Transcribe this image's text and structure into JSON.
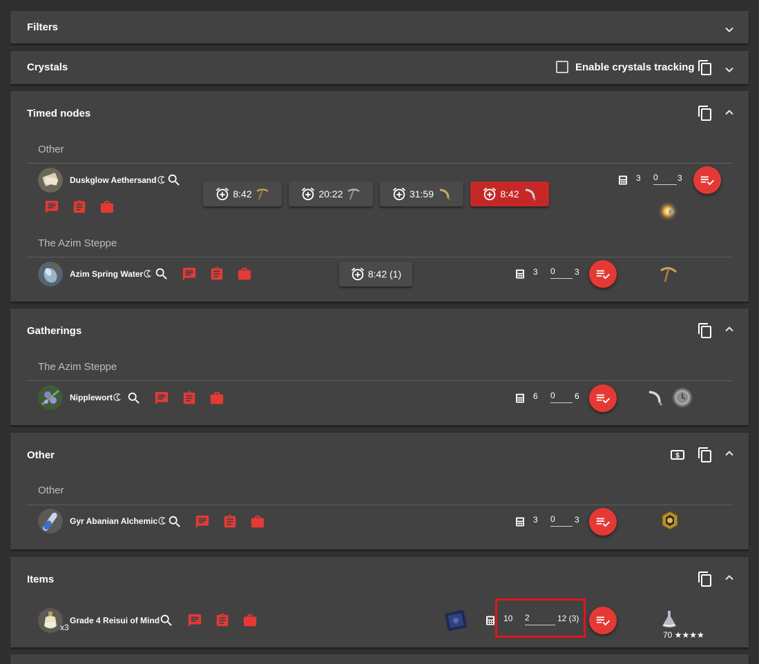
{
  "panels": {
    "filters": {
      "title": "Filters"
    },
    "crystals": {
      "title": "Crystals",
      "tracking_label": "Enable crystals tracking"
    },
    "timed": {
      "title": "Timed nodes",
      "groups": [
        {
          "name": "Other",
          "item": {
            "name": "Duskglow Aethersand",
            "calc": {
              "needed": "3",
              "done": "0",
              "total": "3"
            }
          },
          "timers": [
            {
              "time": "8:42",
              "tool": "pickaxe-icon"
            },
            {
              "time": "20:22",
              "tool": "pickaxe-icon"
            },
            {
              "time": "31:59",
              "tool": "sickle-icon"
            },
            {
              "time": "8:42",
              "tool": "sickle-icon",
              "state": "alert"
            }
          ]
        },
        {
          "name": "The Azim Steppe",
          "item": {
            "name": "Azim Spring Water",
            "calc": {
              "needed": "3",
              "done": "0",
              "total": "3"
            }
          },
          "timers": [
            {
              "time": "8:42 (1)"
            }
          ]
        }
      ]
    },
    "gatherings": {
      "title": "Gatherings",
      "groups": [
        {
          "name": "The Azim Steppe",
          "item": {
            "name": "Nipplewort",
            "calc": {
              "needed": "6",
              "done": "0",
              "total": "6"
            }
          }
        }
      ]
    },
    "other": {
      "title": "Other",
      "groups": [
        {
          "name": "Other",
          "item": {
            "name": "Gyr Abanian Alchemic",
            "calc": {
              "needed": "3",
              "done": "0",
              "total": "3"
            }
          }
        }
      ]
    },
    "items": {
      "title": "Items",
      "item": {
        "name": "Grade 4 Reisui of Mind",
        "qty": "x3",
        "calc": {
          "needed": "10",
          "done": "2",
          "total": "12 (3)"
        },
        "level": "70 ★★★★"
      }
    }
  },
  "colors": {
    "background": "#303030",
    "panel": "#424242",
    "accent": "#e53935",
    "alert": "#c62828",
    "highlight_box": "#e0161e"
  }
}
